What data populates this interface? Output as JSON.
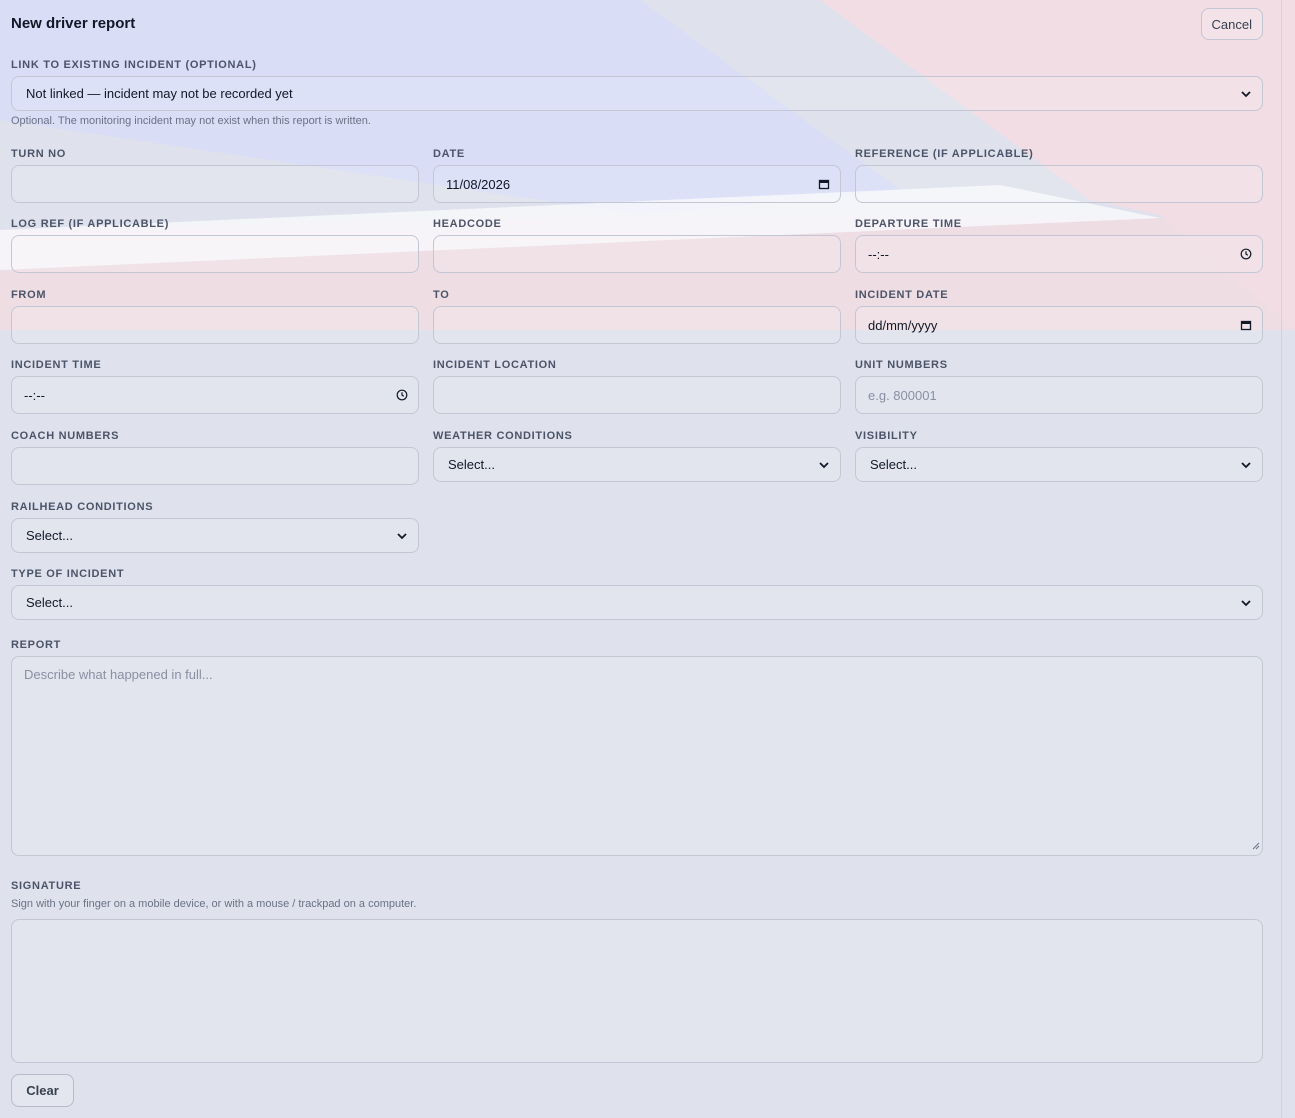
{
  "header": {
    "title": "New driver report",
    "cancel_label": "Cancel"
  },
  "link_incident": {
    "label": "LINK TO EXISTING INCIDENT (OPTIONAL)",
    "value": "Not linked — incident may not be recorded yet",
    "help": "Optional. The monitoring incident may not exist when this report is written."
  },
  "fields": {
    "turn_no": {
      "label": "TURN NO",
      "value": ""
    },
    "date": {
      "label": "DATE",
      "value": "11/08/2026"
    },
    "reference": {
      "label": "REFERENCE (IF APPLICABLE)",
      "value": ""
    },
    "log_ref": {
      "label": "LOG REF (IF APPLICABLE)",
      "value": ""
    },
    "headcode": {
      "label": "HEADCODE",
      "value": ""
    },
    "departure_time": {
      "label": "DEPARTURE TIME",
      "value": "--:--"
    },
    "from": {
      "label": "FROM",
      "value": ""
    },
    "to": {
      "label": "TO",
      "value": ""
    },
    "incident_date": {
      "label": "INCIDENT DATE",
      "value": "dd/mm/yyyy"
    },
    "incident_time": {
      "label": "INCIDENT TIME",
      "value": "--:--"
    },
    "incident_location": {
      "label": "INCIDENT LOCATION",
      "value": ""
    },
    "unit_numbers": {
      "label": "UNIT NUMBERS",
      "placeholder": "e.g. 800001"
    },
    "coach_numbers": {
      "label": "COACH NUMBERS",
      "value": ""
    },
    "weather_conditions": {
      "label": "WEATHER CONDITIONS",
      "value": "Select..."
    },
    "visibility": {
      "label": "VISIBILITY",
      "value": "Select..."
    },
    "railhead_conditions": {
      "label": "RAILHEAD CONDITIONS",
      "value": "Select..."
    },
    "type_of_incident": {
      "label": "TYPE OF INCIDENT",
      "value": "Select..."
    }
  },
  "report": {
    "label": "REPORT",
    "placeholder": "Describe what happened in full..."
  },
  "signature": {
    "label": "SIGNATURE",
    "help": "Sign with your finger on a mobile device, or with a mouse / trackpad on a computer.",
    "clear_label": "Clear"
  },
  "icons": {
    "select": "chevron-down-icon",
    "date": "calendar-icon",
    "time": "clock-icon"
  }
}
